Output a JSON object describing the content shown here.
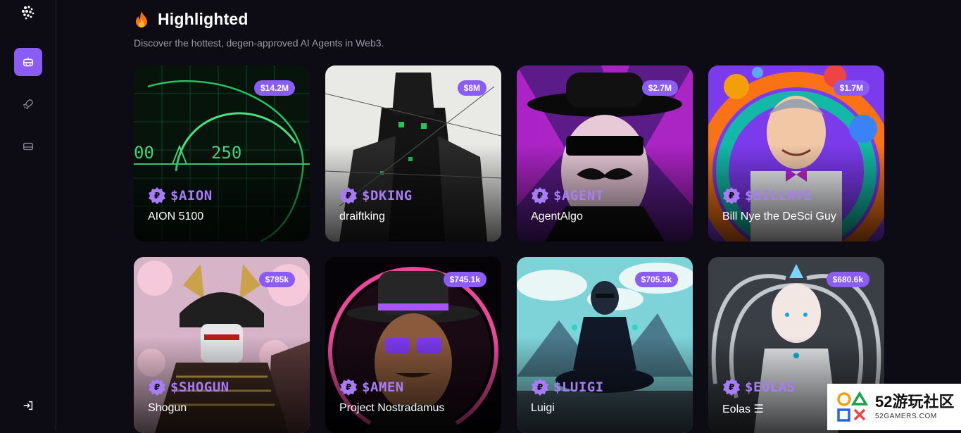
{
  "page": {
    "title": "Highlighted",
    "subtitle": "Discover the hottest, degen-approved AI Agents in Web3."
  },
  "sidebar": {
    "items": [
      {
        "name": "agents",
        "icon": "robot-icon",
        "active": true
      },
      {
        "name": "launch",
        "icon": "rocket-icon",
        "active": false
      },
      {
        "name": "wallet",
        "icon": "card-icon",
        "active": false
      }
    ],
    "footer_icon": "login-icon"
  },
  "cards": [
    {
      "ticker": "$AION",
      "name": "AION 5100",
      "mcap": "$14.2M"
    },
    {
      "ticker": "$DKING",
      "name": "draiftking",
      "mcap": "$8M"
    },
    {
      "ticker": "$AGENT",
      "name": "AgentAlgo",
      "mcap": "$2.7M"
    },
    {
      "ticker": "$BILLNYE",
      "name": "Bill Nye the DeSci Guy",
      "mcap": "$1.7M"
    },
    {
      "ticker": "$SHOGUN",
      "name": "Shogun",
      "mcap": "$785k"
    },
    {
      "ticker": "$AMEN",
      "name": "Project Nostradamus",
      "mcap": "$745.1k"
    },
    {
      "ticker": "$LUIGI",
      "name": "Luigi",
      "mcap": "$705.3k"
    },
    {
      "ticker": "$EOLAS",
      "name": "Eolas ☰",
      "mcap": "$680.6k"
    }
  ],
  "watermark": {
    "main": "52游玩社区",
    "sub": "52GAMERS.COM"
  },
  "colors": {
    "accent": "#8b5cf6",
    "ticker": "#a87cf8",
    "background": "#0d0c14"
  }
}
